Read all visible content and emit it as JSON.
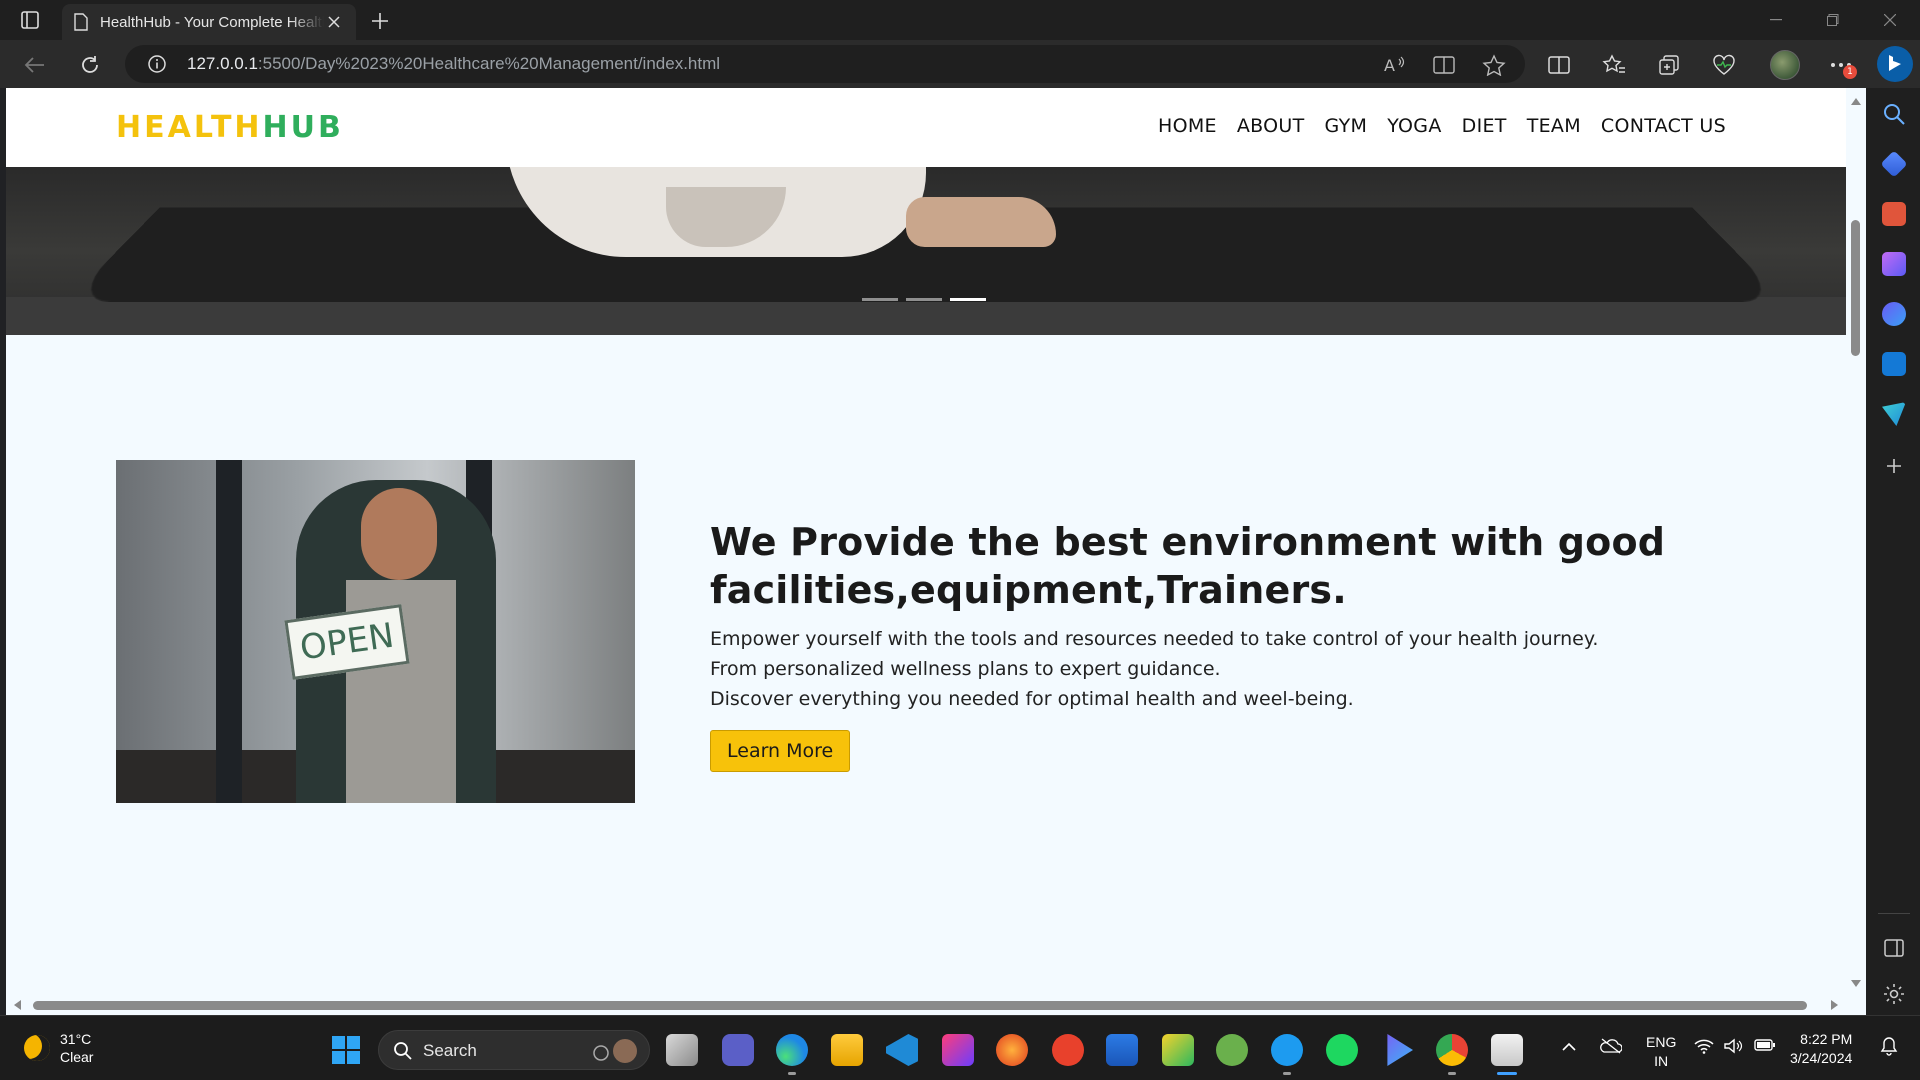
{
  "browser": {
    "tab_title": "HealthHub - Your Complete Health",
    "url_host": "127.0.0.1",
    "url_rest": ":5500/Day%2023%20Healthcare%20Management/index.html",
    "notification_badge": "1"
  },
  "site": {
    "logo_part1": "HEALTH",
    "logo_part2": "HUB",
    "nav": [
      "HOME",
      "ABOUT",
      "GYM",
      "YOGA",
      "DIET",
      "TEAM",
      "CONTACT US"
    ],
    "colors": {
      "logo_yellow": "#f4c20d",
      "logo_green": "#2fae5c",
      "button": "#f7c20a",
      "page_bg": "#f3faff"
    }
  },
  "hero": {
    "indicator_count": 3,
    "active_indicator": 3
  },
  "about": {
    "image_sign_text": "OPEN",
    "heading": "We Provide the best environment with good facilities,equipment,Trainers.",
    "lines": [
      "Empower yourself with the tools and resources needed to take control of your health journey.",
      "From personalized wellness plans to expert guidance.",
      "Discover everything you needed for optimal health and weel-being."
    ],
    "button_label": "Learn More"
  },
  "taskbar": {
    "weather_temp": "31°C",
    "weather_desc": "Clear",
    "search_label": "Search",
    "lang_line1": "ENG",
    "lang_line2": "IN",
    "time": "8:22 PM",
    "date": "3/24/2024"
  }
}
